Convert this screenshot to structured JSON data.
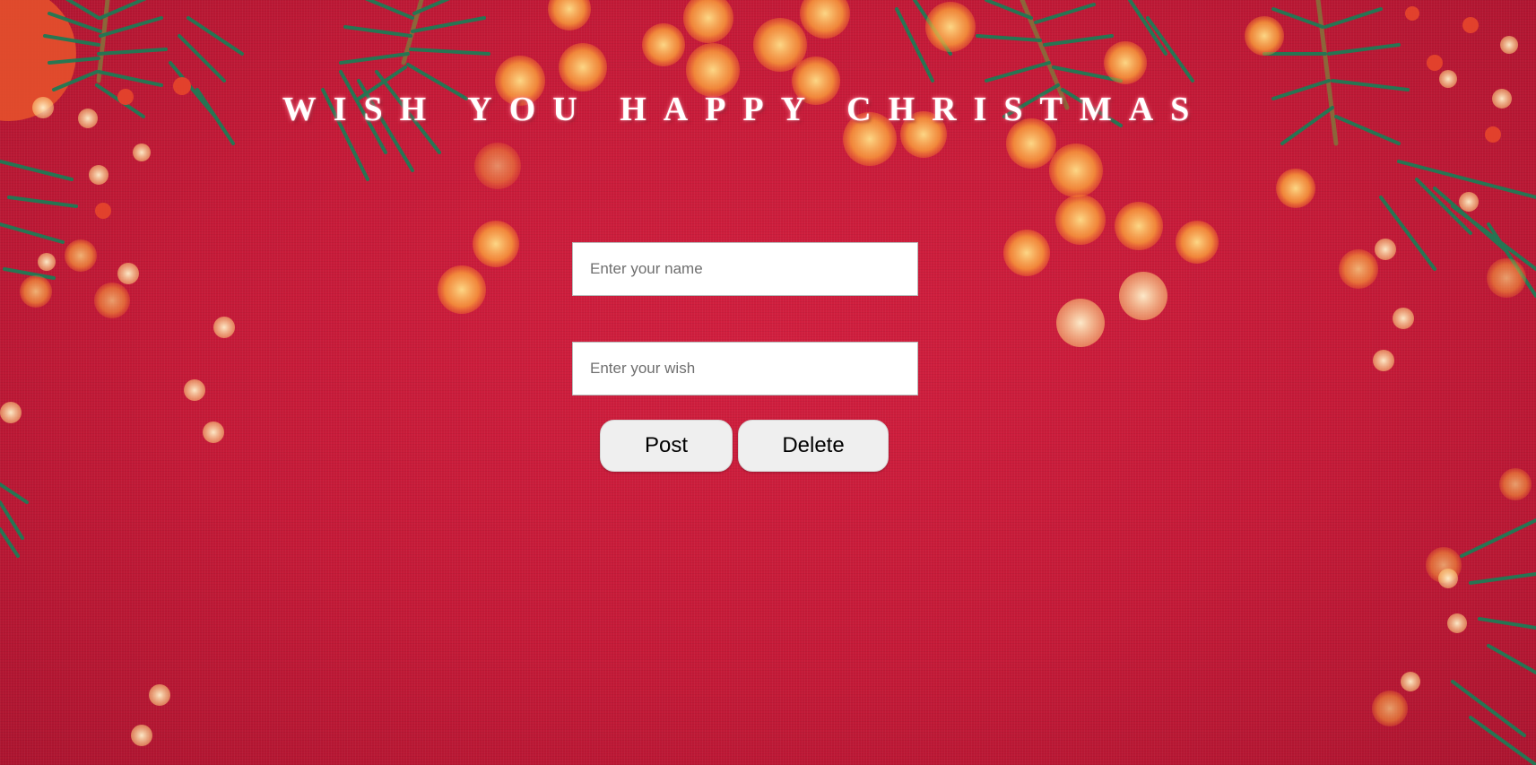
{
  "page": {
    "title": "WISH YOU HAPPY CHRISTMAS"
  },
  "form": {
    "name_placeholder": "Enter your name",
    "name_value": "",
    "wish_placeholder": "Enter your wish",
    "wish_value": ""
  },
  "buttons": {
    "post_label": "Post",
    "delete_label": "Delete"
  },
  "colors": {
    "background": "#c51a38",
    "pine": "#1f7a55",
    "bokeh": "#ffb347",
    "title_glow": "#ff8fa3"
  },
  "icons": [
    "pine-branch-decoration",
    "bokeh-light-decoration"
  ]
}
